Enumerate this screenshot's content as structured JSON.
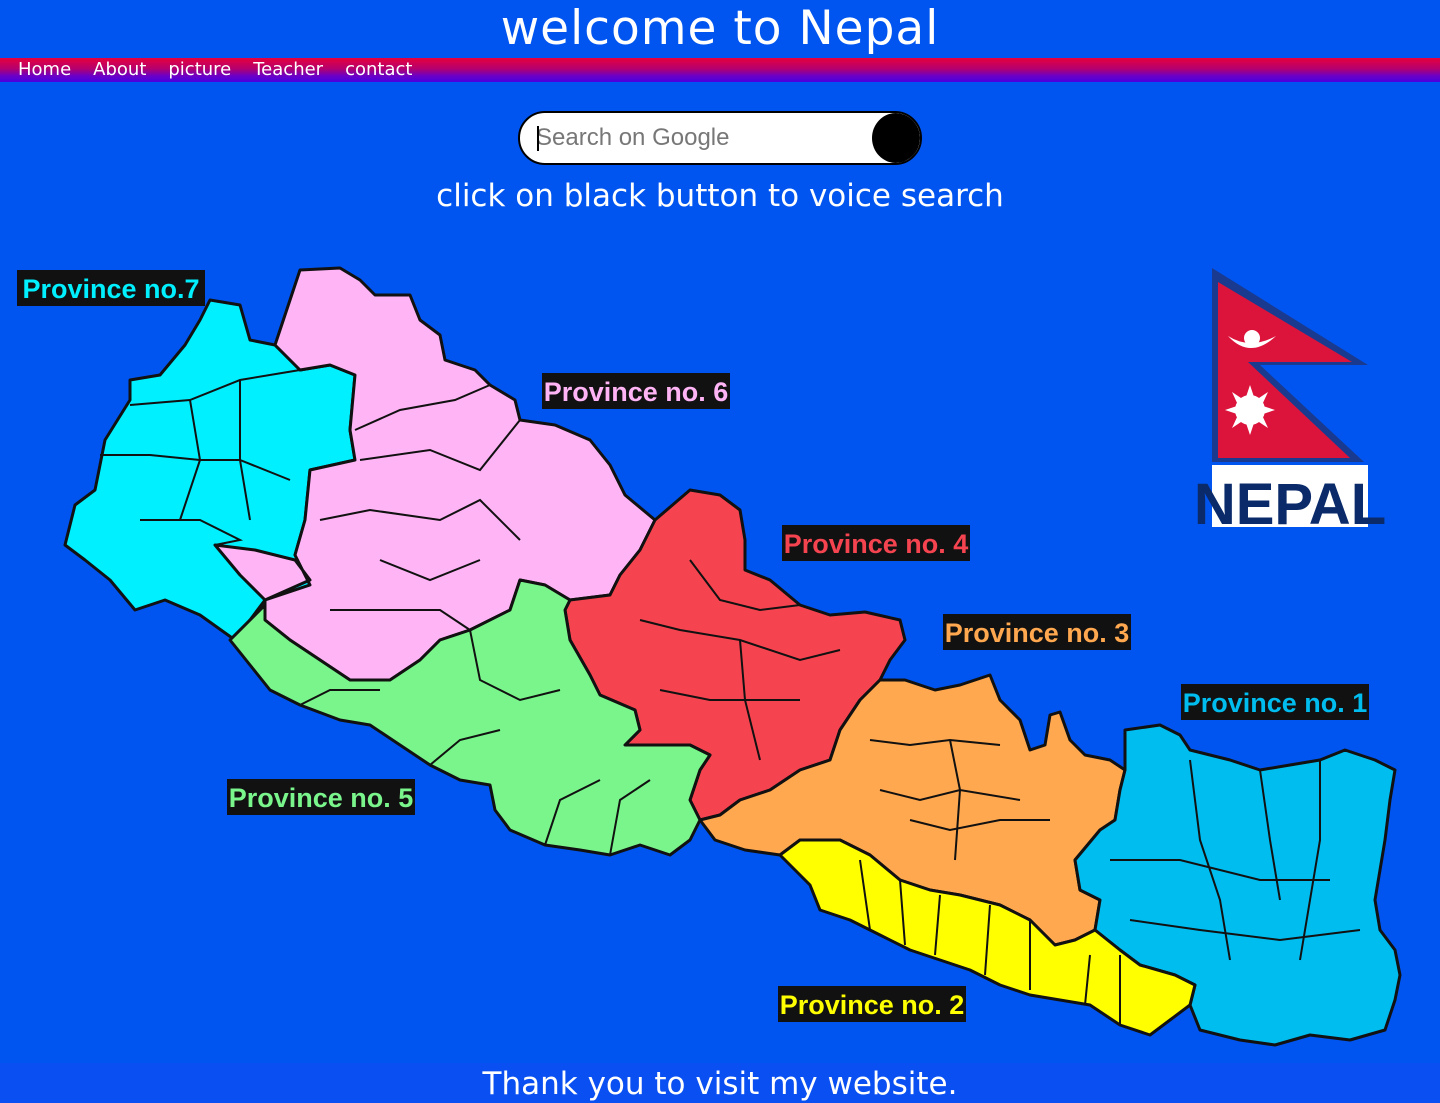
{
  "header": {
    "title": "welcome to Nepal"
  },
  "nav": {
    "items": [
      {
        "label": "Home"
      },
      {
        "label": "About"
      },
      {
        "label": "picture"
      },
      {
        "label": "Teacher"
      },
      {
        "label": "contact"
      }
    ]
  },
  "search": {
    "placeholder": "Search on Google",
    "value": ""
  },
  "hint": "click on black button to voice search",
  "map": {
    "provinces": [
      {
        "label": "Province no.7",
        "color": "#00f0ff"
      },
      {
        "label": "Province no. 6",
        "color": "#ffb4f5"
      },
      {
        "label": "Province no. 4",
        "color": "#f54450"
      },
      {
        "label": "Province no. 3",
        "color": "#ffa84f"
      },
      {
        "label": "Province no. 1",
        "color": "#00bdf0"
      },
      {
        "label": "Province no. 5",
        "color": "#7af58c"
      },
      {
        "label": "Province no. 2",
        "color": "#ffff00"
      }
    ],
    "emblem_text": "NEPAL"
  },
  "footer": {
    "text": "Thank you to visit my website."
  }
}
